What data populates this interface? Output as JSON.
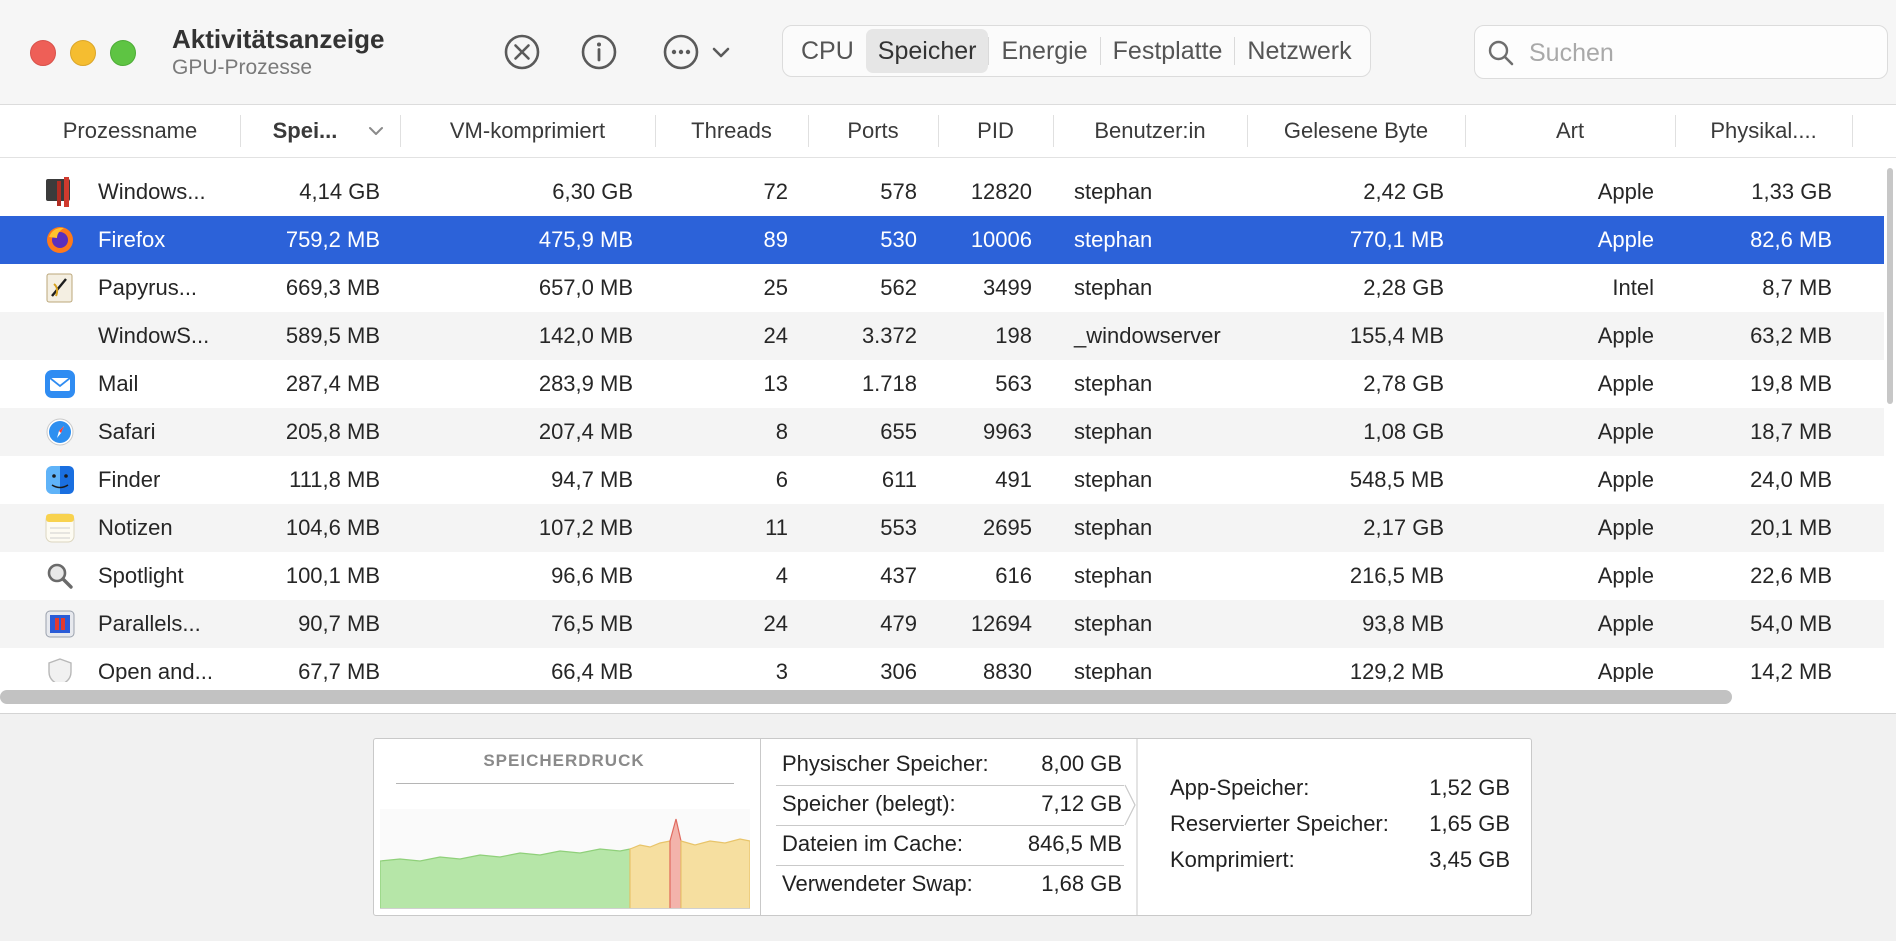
{
  "window": {
    "title": "Aktivitätsanzeige",
    "subtitle": "GPU-Prozesse"
  },
  "toolbar": {
    "stop_icon": "xmark-circle-icon",
    "info_icon": "info-circle-icon",
    "more_icon": "ellipsis-circle-icon",
    "tabs": [
      "CPU",
      "Speicher",
      "Energie",
      "Festplatte",
      "Netzwerk"
    ],
    "active_tab": "Speicher",
    "search_placeholder": "Suchen"
  },
  "table": {
    "columns": [
      "Prozessname",
      "Spei...",
      "VM-komprimiert",
      "Threads",
      "Ports",
      "PID",
      "Benutzer:in",
      "Gelesene Byte",
      "Art",
      "Physikal...."
    ],
    "sort_column": "Spei...",
    "rows": [
      {
        "icon": "windows-vm-icon",
        "name": "Windows...",
        "mem": "4,14 GB",
        "vm": "6,30 GB",
        "threads": "72",
        "ports": "578",
        "pid": "12820",
        "user": "stephan",
        "read": "2,42 GB",
        "art": "Apple",
        "phys": "1,33 GB"
      },
      {
        "icon": "firefox-icon",
        "name": "Firefox",
        "mem": "759,2 MB",
        "vm": "475,9 MB",
        "threads": "89",
        "ports": "530",
        "pid": "10006",
        "user": "stephan",
        "read": "770,1 MB",
        "art": "Apple",
        "phys": "82,6 MB",
        "selected": true
      },
      {
        "icon": "papyrus-icon",
        "name": "Papyrus...",
        "mem": "669,3 MB",
        "vm": "657,0 MB",
        "threads": "25",
        "ports": "562",
        "pid": "3499",
        "user": "stephan",
        "read": "2,28 GB",
        "art": "Intel",
        "phys": "8,7 MB"
      },
      {
        "icon": "",
        "name": "WindowS...",
        "mem": "589,5 MB",
        "vm": "142,0 MB",
        "threads": "24",
        "ports": "3.372",
        "pid": "198",
        "user": "_windowserver",
        "read": "155,4 MB",
        "art": "Apple",
        "phys": "63,2 MB"
      },
      {
        "icon": "mail-icon",
        "name": "Mail",
        "mem": "287,4 MB",
        "vm": "283,9 MB",
        "threads": "13",
        "ports": "1.718",
        "pid": "563",
        "user": "stephan",
        "read": "2,78 GB",
        "art": "Apple",
        "phys": "19,8 MB"
      },
      {
        "icon": "safari-icon",
        "name": "Safari",
        "mem": "205,8 MB",
        "vm": "207,4 MB",
        "threads": "8",
        "ports": "655",
        "pid": "9963",
        "user": "stephan",
        "read": "1,08 GB",
        "art": "Apple",
        "phys": "18,7 MB"
      },
      {
        "icon": "finder-icon",
        "name": "Finder",
        "mem": "111,8 MB",
        "vm": "94,7 MB",
        "threads": "6",
        "ports": "611",
        "pid": "491",
        "user": "stephan",
        "read": "548,5 MB",
        "art": "Apple",
        "phys": "24,0 MB"
      },
      {
        "icon": "notes-icon",
        "name": "Notizen",
        "mem": "104,6 MB",
        "vm": "107,2 MB",
        "threads": "11",
        "ports": "553",
        "pid": "2695",
        "user": "stephan",
        "read": "2,17 GB",
        "art": "Apple",
        "phys": "20,1 MB"
      },
      {
        "icon": "spotlight-icon",
        "name": "Spotlight",
        "mem": "100,1 MB",
        "vm": "96,6 MB",
        "threads": "4",
        "ports": "437",
        "pid": "616",
        "user": "stephan",
        "read": "216,5 MB",
        "art": "Apple",
        "phys": "22,6 MB"
      },
      {
        "icon": "parallels-icon",
        "name": "Parallels...",
        "mem": "90,7 MB",
        "vm": "76,5 MB",
        "threads": "24",
        "ports": "479",
        "pid": "12694",
        "user": "stephan",
        "read": "93,8 MB",
        "art": "Apple",
        "phys": "54,0 MB"
      },
      {
        "icon": "shield-icon",
        "name": "Open and...",
        "mem": "67,7 MB",
        "vm": "66,4 MB",
        "threads": "3",
        "ports": "306",
        "pid": "8830",
        "user": "stephan",
        "read": "129,2 MB",
        "art": "Apple",
        "phys": "14,2 MB"
      }
    ]
  },
  "memory_pressure": {
    "title": "SPEICHERDRUCK",
    "colors": {
      "green": "#9ee28c",
      "yellow": "#f5d98c",
      "red": "#f08a80"
    }
  },
  "memory_stats": {
    "physical_label": "Physischer Speicher:",
    "physical_value": "8,00 GB",
    "used_label": "Speicher (belegt):",
    "used_value": "7,12 GB",
    "cache_label": "Dateien im Cache:",
    "cache_value": "846,5 MB",
    "swap_label": "Verwendeter Swap:",
    "swap_value": "1,68 GB",
    "app_label": "App-Speicher:",
    "app_value": "1,52 GB",
    "wired_label": "Reservierter Speicher:",
    "wired_value": "1,65 GB",
    "compressed_label": "Komprimiert:",
    "compressed_value": "3,45 GB"
  },
  "accent_color": "#2c62d9"
}
